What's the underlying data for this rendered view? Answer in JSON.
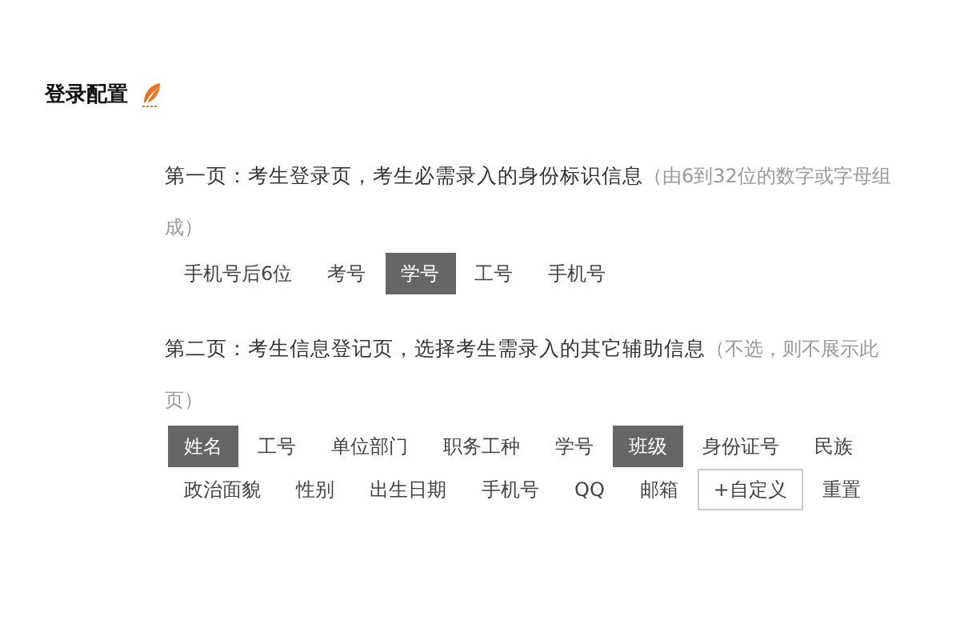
{
  "title": "登录配置",
  "sections": [
    {
      "heading": "第一页：考生登录页，考生必需录入的身份标识信息",
      "note": "（由6到32位的数字或字母组成）",
      "options": [
        {
          "label": "手机号后6位",
          "kind": "option",
          "selected": false
        },
        {
          "label": "考号",
          "kind": "option",
          "selected": false
        },
        {
          "label": "学号",
          "kind": "option",
          "selected": true
        },
        {
          "label": "工号",
          "kind": "option",
          "selected": false
        },
        {
          "label": "手机号",
          "kind": "option",
          "selected": false
        }
      ]
    },
    {
      "heading": "第二页：考生信息登记页，选择考生需录入的其它辅助信息",
      "note": "（不选，则不展示此页）",
      "options": [
        {
          "label": "姓名",
          "kind": "option",
          "selected": true
        },
        {
          "label": "工号",
          "kind": "option",
          "selected": false
        },
        {
          "label": "单位部门",
          "kind": "option",
          "selected": false
        },
        {
          "label": "职务工种",
          "kind": "option",
          "selected": false
        },
        {
          "label": "学号",
          "kind": "option",
          "selected": false
        },
        {
          "label": "班级",
          "kind": "option",
          "selected": true
        },
        {
          "label": "身份证号",
          "kind": "option",
          "selected": false
        },
        {
          "label": "民族",
          "kind": "option",
          "selected": false
        },
        {
          "label": "政治面貌",
          "kind": "option",
          "selected": false
        },
        {
          "label": "性别",
          "kind": "option",
          "selected": false
        },
        {
          "label": "出生日期",
          "kind": "option",
          "selected": false
        },
        {
          "label": "手机号",
          "kind": "option",
          "selected": false
        },
        {
          "label": "QQ",
          "kind": "option",
          "selected": false
        },
        {
          "label": "邮箱",
          "kind": "option",
          "selected": false
        },
        {
          "label": "+自定义",
          "kind": "custom"
        },
        {
          "label": "重置",
          "kind": "reset"
        }
      ]
    }
  ]
}
